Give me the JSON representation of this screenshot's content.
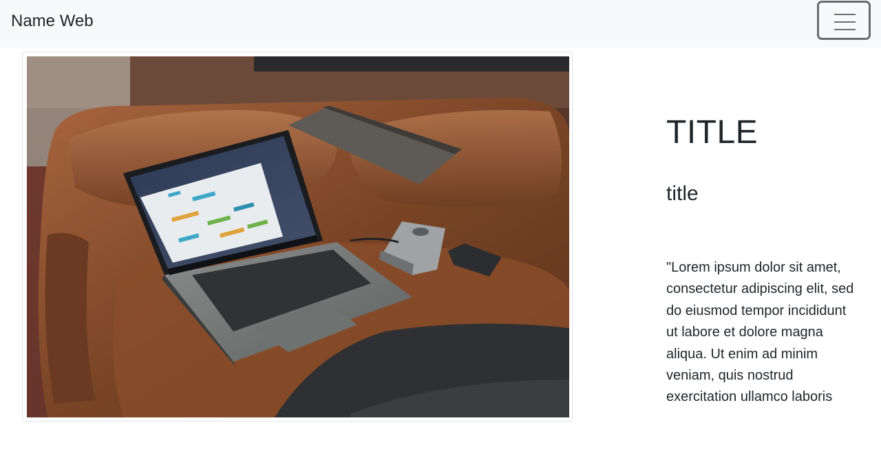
{
  "navbar": {
    "brand": "Name Web",
    "toggler_icon": "hamburger-menu-icon"
  },
  "image": {
    "alt": "Laptop on a leather couch"
  },
  "content": {
    "title": "TITLE",
    "subtitle": "title",
    "text": "\"Lorem ipsum dolor sit amet, consectetur adipiscing elit, sed do eiusmod tempor incididunt ut labore et dolore magna aliqua. Ut enim ad minim veniam, quis nostrud exercitation ullamco laboris"
  },
  "colors": {
    "navbar_bg": "#f8f9fa",
    "text": "#212529",
    "toggler_border": "#676b6f"
  }
}
